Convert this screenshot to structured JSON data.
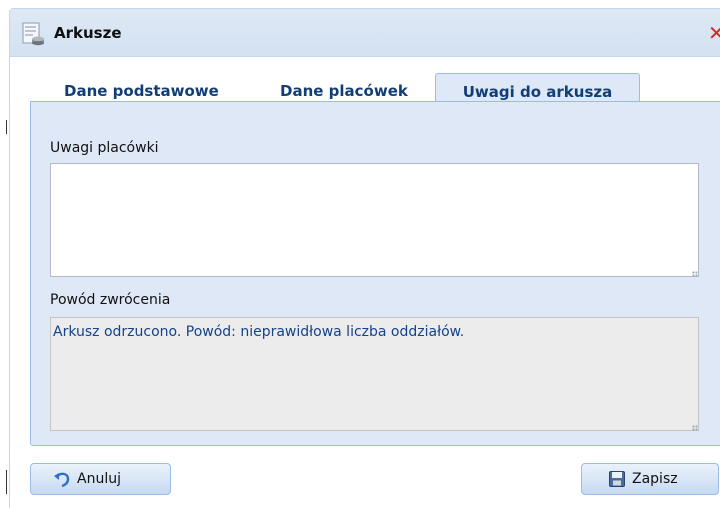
{
  "window": {
    "title": "Arkusze"
  },
  "tabs": [
    {
      "label": "Dane podstawowe",
      "active": false
    },
    {
      "label": "Dane placówek",
      "active": false
    },
    {
      "label": "Uwagi do arkusza",
      "active": true
    }
  ],
  "form": {
    "uwagi_label": "Uwagi placówki",
    "uwagi_value": "",
    "powod_label": "Powód zwrócenia",
    "powod_value": "Arkusz odrzucono. Powód: nieprawidłowa liczba oddziałów."
  },
  "buttons": {
    "cancel_label": "Anuluj",
    "save_label": "Zapisz"
  },
  "icons": {
    "title": "document-stack-icon",
    "close": "close-icon",
    "cancel": "undo-arrow-icon",
    "save": "floppy-disk-icon"
  },
  "colors": {
    "tab_text": "#123e76",
    "panel_bg": "#dfe8f6",
    "close_red": "#d7291f",
    "readonly_text": "#15428b"
  }
}
